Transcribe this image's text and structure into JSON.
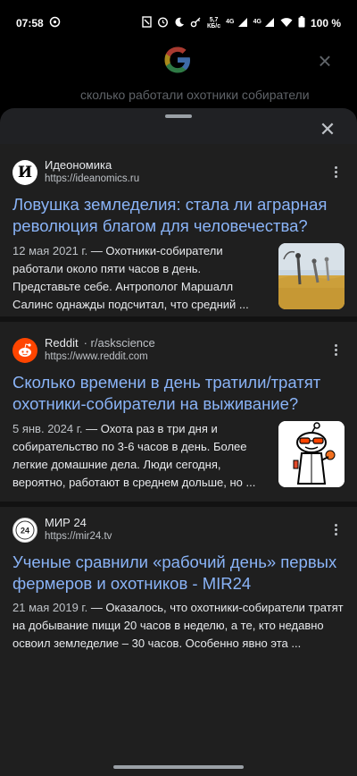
{
  "status_bar": {
    "time": "07:58",
    "net_speed_value": "5,7",
    "net_speed_unit": "КБ/с",
    "lte_label_1": "4G",
    "lte_label_2": "4G",
    "battery": "100 %"
  },
  "background": {
    "query": "сколько работали охотники собиратели"
  },
  "results": [
    {
      "source_name": "Идеономика",
      "source_sub": "",
      "url": "https://ideanomics.ru",
      "favicon_letter": "И",
      "title": "Ловушка земледелия: стала ли аграрная революция благом для человечества?",
      "date": "12 мая 2021 г.",
      "snippet": " — Охотники-собиратели работали около пяти часов в день. Представьте себе. Антрополог Маршалл Салинс однажды подсчитал, что средний ..."
    },
    {
      "source_name": "Reddit",
      "source_sub": "· r/askscience",
      "url": "https://www.reddit.com",
      "favicon_letter": "",
      "title": "Сколько времени в день тратили/тратят охотники-собиратели на выживание?",
      "date": "5 янв. 2024 г.",
      "snippet": " — Охота раз в три дня и собирательство по 3-6 часов в день. Более легкие домашние дела. Люди сегодня, вероятно, работают в среднем дольше, но ..."
    },
    {
      "source_name": "МИР 24",
      "source_sub": "",
      "url": "https://mir24.tv",
      "favicon_letter": "24",
      "title": "Ученые сравнили «рабочий день» первых фермеров и охотников - MIR24",
      "date": "21 мая 2019 г.",
      "snippet": " — Оказалось, что охотники-собиратели тратят на добывание пищи 20 часов в неделю, а те, кто недавно освоил земледелие – 30 часов. Особенно явно эта ..."
    }
  ],
  "icons": {
    "close": "close-icon",
    "more": "more-vert-icon"
  },
  "colors": {
    "link": "#8ab4f8",
    "sheet_bg": "#202124",
    "reddit": "#ff4500"
  }
}
